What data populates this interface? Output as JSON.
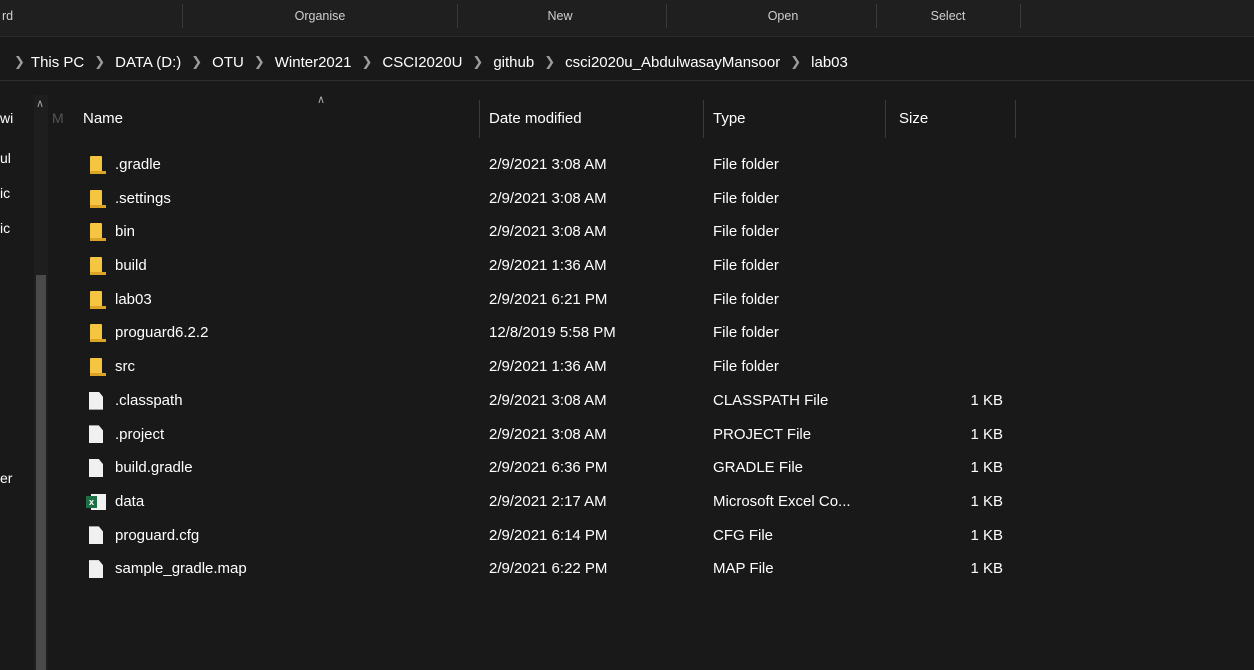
{
  "ribbon": {
    "groups": [
      "rd",
      "Organise",
      "New",
      "Open",
      "Select"
    ]
  },
  "address": {
    "path": [
      "This PC",
      "DATA (D:)",
      "OTU",
      "Winter2021",
      "CSCI2020U",
      "github",
      "csci2020u_AbdulwasayMansoor",
      "lab03"
    ]
  },
  "nav_pane": {
    "fragments": [
      "wi",
      "ul",
      "ic",
      "ic",
      "er"
    ],
    "dim_fragment": "M"
  },
  "columns": {
    "name": "Name",
    "date": "Date modified",
    "type": "Type",
    "size": "Size"
  },
  "files": [
    {
      "icon": "folder-icon",
      "name": ".gradle",
      "date": "2/9/2021 3:08 AM",
      "type": "File folder",
      "size": ""
    },
    {
      "icon": "folder-icon",
      "name": ".settings",
      "date": "2/9/2021 3:08 AM",
      "type": "File folder",
      "size": ""
    },
    {
      "icon": "folder-icon",
      "name": "bin",
      "date": "2/9/2021 3:08 AM",
      "type": "File folder",
      "size": ""
    },
    {
      "icon": "folder-icon",
      "name": "build",
      "date": "2/9/2021 1:36 AM",
      "type": "File folder",
      "size": ""
    },
    {
      "icon": "folder-icon",
      "name": "lab03",
      "date": "2/9/2021 6:21 PM",
      "type": "File folder",
      "size": ""
    },
    {
      "icon": "folder-icon",
      "name": "proguard6.2.2",
      "date": "12/8/2019 5:58 PM",
      "type": "File folder",
      "size": ""
    },
    {
      "icon": "folder-icon",
      "name": "src",
      "date": "2/9/2021 1:36 AM",
      "type": "File folder",
      "size": ""
    },
    {
      "icon": "file-icon",
      "name": ".classpath",
      "date": "2/9/2021 3:08 AM",
      "type": "CLASSPATH File",
      "size": "1 KB"
    },
    {
      "icon": "file-icon",
      "name": ".project",
      "date": "2/9/2021 3:08 AM",
      "type": "PROJECT File",
      "size": "1 KB"
    },
    {
      "icon": "file-icon",
      "name": "build.gradle",
      "date": "2/9/2021 6:36 PM",
      "type": "GRADLE File",
      "size": "1 KB"
    },
    {
      "icon": "excel-icon",
      "name": "data",
      "date": "2/9/2021 2:17 AM",
      "type": "Microsoft Excel Co...",
      "size": "1 KB"
    },
    {
      "icon": "file-icon",
      "name": "proguard.cfg",
      "date": "2/9/2021 6:14 PM",
      "type": "CFG File",
      "size": "1 KB"
    },
    {
      "icon": "file-icon",
      "name": "sample_gradle.map",
      "date": "2/9/2021 6:22 PM",
      "type": "MAP File",
      "size": "1 KB"
    }
  ],
  "colors": {
    "background": "#191919",
    "folder": "#f5c542",
    "excel": "#1d7044"
  }
}
